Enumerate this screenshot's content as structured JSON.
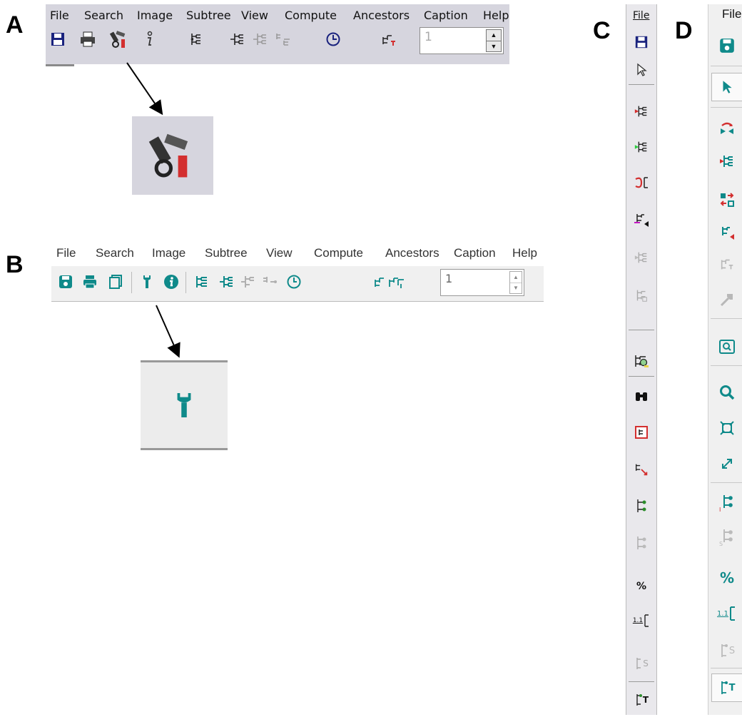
{
  "panel_labels": {
    "a": "A",
    "b": "B",
    "c": "C",
    "d": "D"
  },
  "panel_a": {
    "menu": [
      "File",
      "Search",
      "Image",
      "Subtree",
      "View",
      "Compute",
      "Ancestors",
      "Caption",
      "Help"
    ],
    "menu_underlined_letters": [
      "F",
      "S",
      "I",
      "u",
      "V",
      "C",
      "A",
      "p",
      "H"
    ],
    "spinner_value": "1",
    "icons": [
      "save-icon",
      "print-icon",
      "tools-icon",
      "info-icon",
      "tree-icon",
      "subtree-icon",
      "tree-disabled-icon",
      "swap-disabled-icon",
      "clock-icon",
      "caption-tree-icon"
    ]
  },
  "panel_b": {
    "menu": [
      "File",
      "Search",
      "Image",
      "Subtree",
      "View",
      "Compute",
      "Ancestors",
      "Caption",
      "Help"
    ],
    "spinner_value": "1",
    "icons": [
      "save-icon",
      "print-icon",
      "copy-icon",
      "wrench-icon",
      "info-icon",
      "tree-icon",
      "subtree-icon",
      "tree-disabled-icon",
      "swap-disabled-icon",
      "clock-icon",
      "caption-tree-icon"
    ]
  },
  "panel_c": {
    "menu_label": "File",
    "percent_label": "%",
    "ratio_label": "1.1",
    "caption_s": "S",
    "caption_t": "T"
  },
  "panel_d": {
    "menu_label": "File",
    "percent_label": "%",
    "ratio_label": "1.1",
    "caption_s": "S",
    "caption_t": "T"
  },
  "colors": {
    "panel_a_bar": "#d6d5de",
    "panel_b_bar": "#f0f0f0",
    "teal": "#0f8a8a",
    "navy": "#1a237e",
    "red": "#d32f2f"
  }
}
